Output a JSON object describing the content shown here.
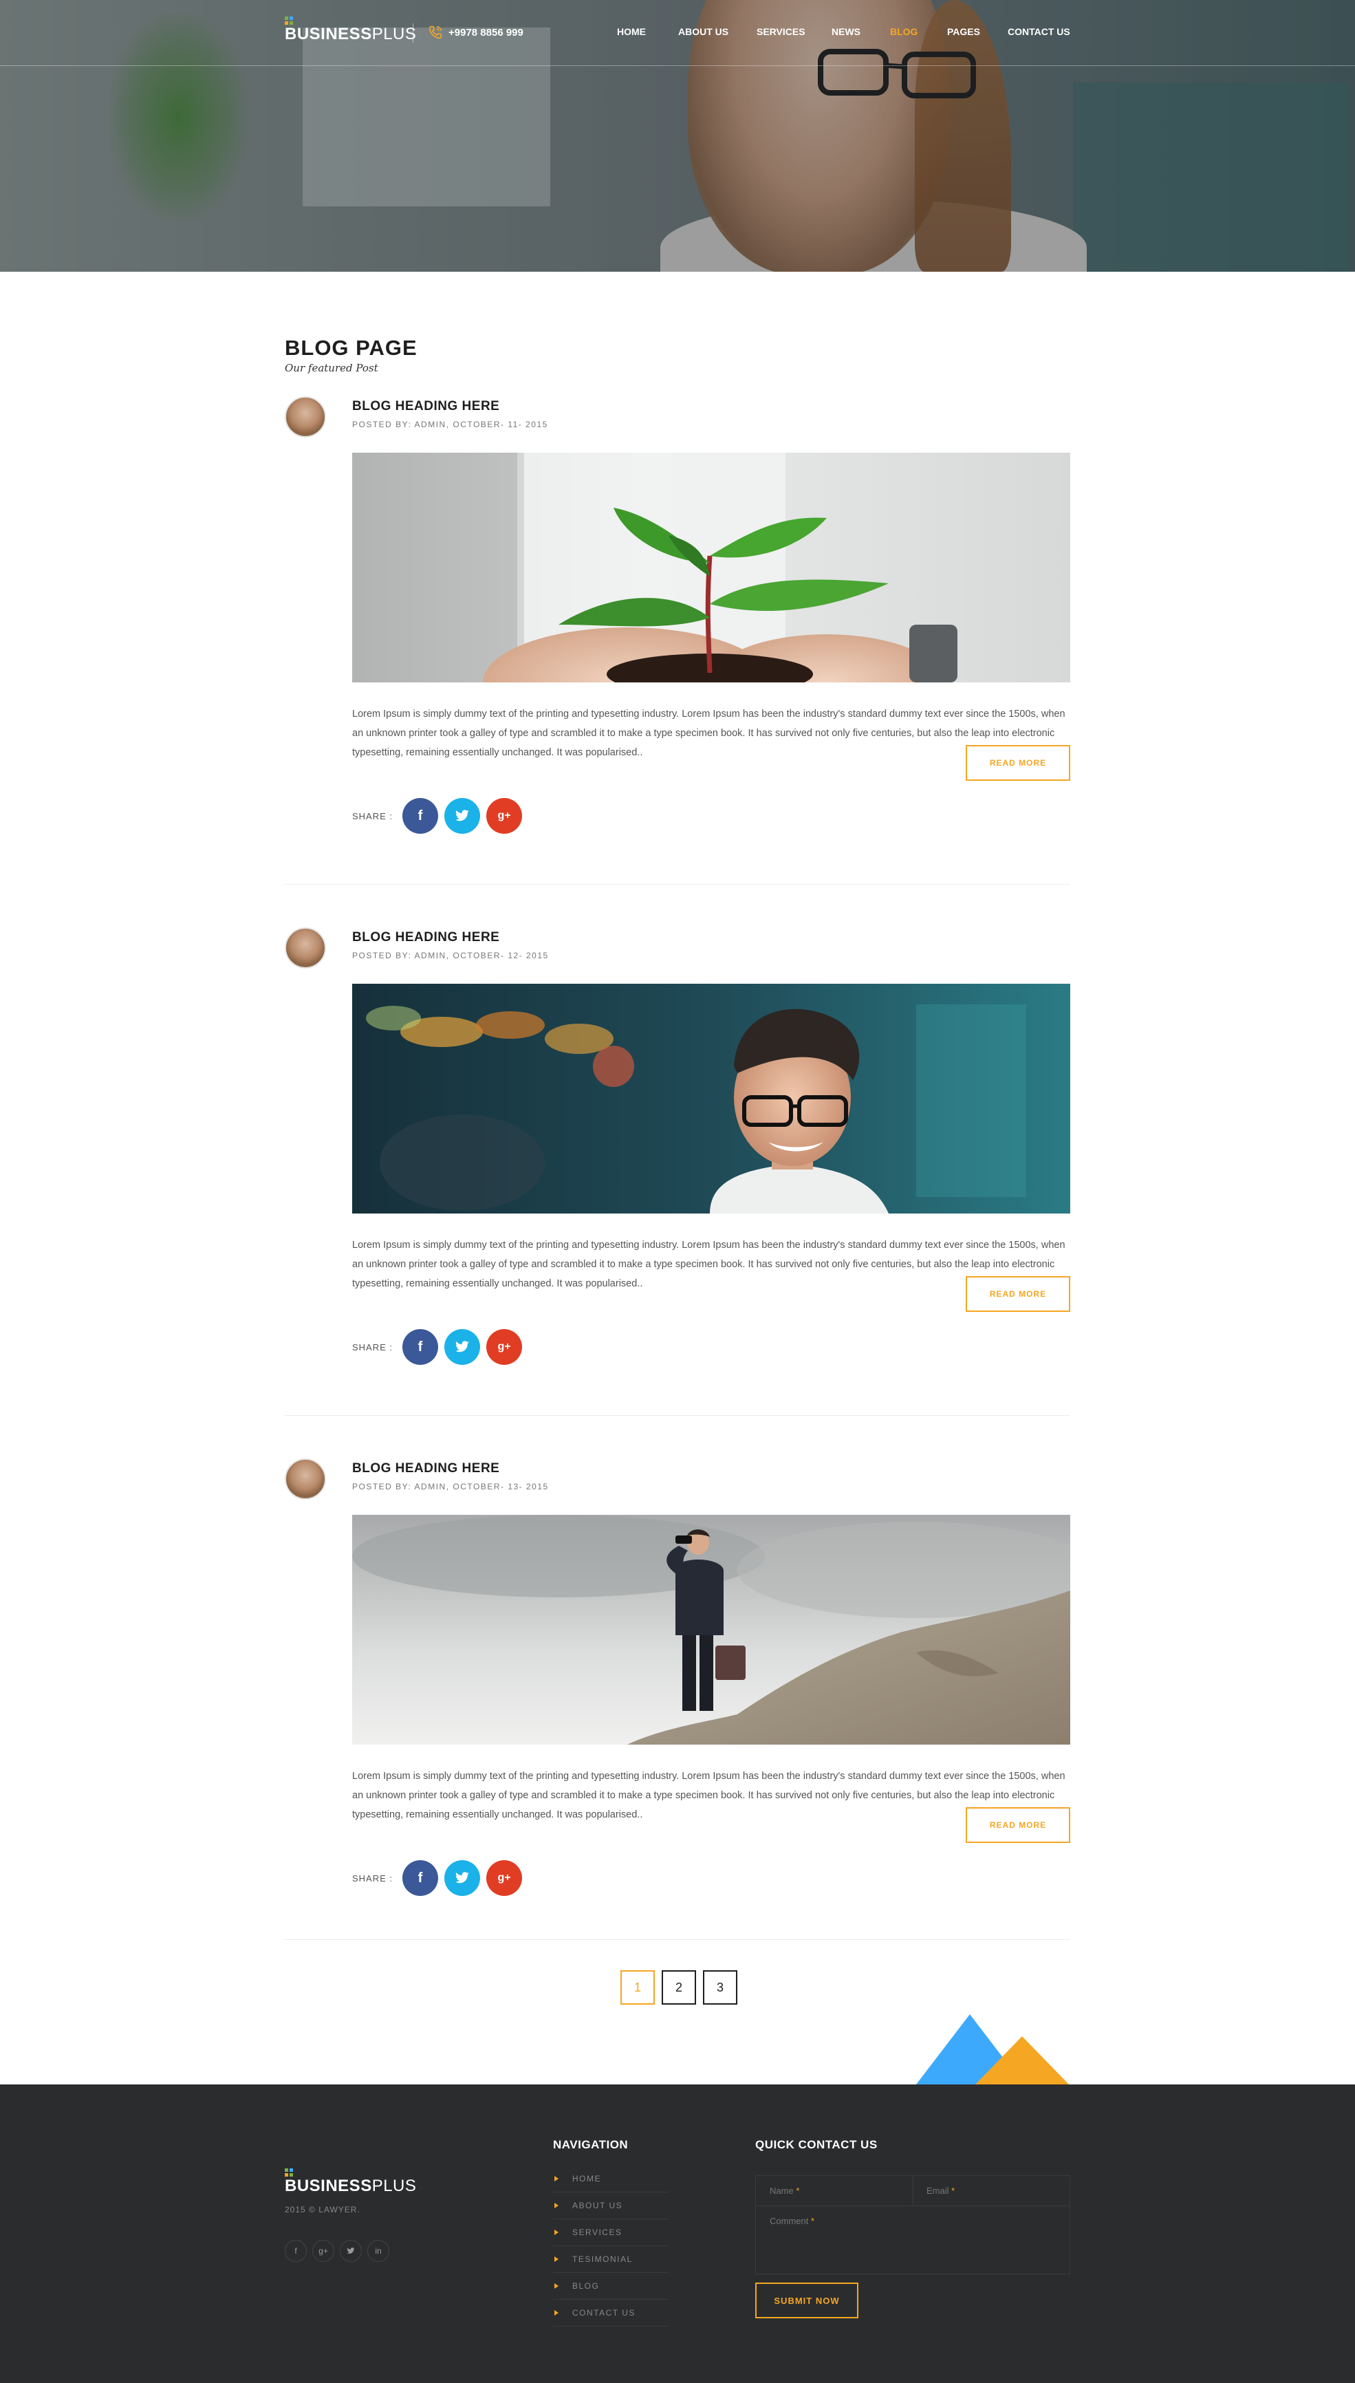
{
  "brand": {
    "name_bold": "BUSINESS",
    "name_light": "PLUS",
    "colors": {
      "accent": "#f5a623",
      "dot_green": "#7cb342",
      "dot_blue": "#3da9fc",
      "dot_orange": "#f5a623"
    }
  },
  "header": {
    "phone_icon": "phone-icon",
    "phone": "+9978 8856 999",
    "nav": [
      "HOME",
      "ABOUT US",
      "SERVICES",
      "NEWS",
      "BLOG",
      "PAGES",
      "CONTACT US"
    ],
    "active_nav": "BLOG"
  },
  "page": {
    "title": "BLOG PAGE",
    "subtitle": "Our featured Post"
  },
  "posts": [
    {
      "title": "BLOG HEADING HERE",
      "meta": "POSTED BY: ADMIN,  OCTOBER- 11- 2015",
      "image": "plant-in-hands",
      "text": "Lorem Ipsum is simply dummy text of the printing and typesetting industry. Lorem Ipsum has been the industry's standard dummy text ever since the 1500s, when an unknown printer took a galley of type and scrambled it to make a type specimen book. It has survived not only five centuries, but also the leap into electronic typesetting, remaining essentially unchanged. It was popularised..",
      "share_label": "SHARE :",
      "read_more": "READ MORE"
    },
    {
      "title": "BLOG HEADING HERE",
      "meta": "POSTED BY: ADMIN,  OCTOBER- 12- 2015",
      "image": "smiling-man-with-glasses",
      "text": "Lorem Ipsum is simply dummy text of the printing and typesetting industry. Lorem Ipsum has been the industry's standard dummy text ever since the 1500s, when an unknown printer took a galley of type and scrambled it to make a type specimen book. It has survived not only five centuries, but also the leap into electronic typesetting, remaining essentially unchanged. It was popularised..",
      "share_label": "SHARE :",
      "read_more": "READ MORE"
    },
    {
      "title": "BLOG HEADING HERE",
      "meta": "POSTED BY: ADMIN,  OCTOBER- 13- 2015",
      "image": "businessman-with-binoculars-on-rock",
      "text": "Lorem Ipsum is simply dummy text of the printing and typesetting industry. Lorem Ipsum has been the industry's standard dummy text ever since the 1500s, when an unknown printer took a galley of type and scrambled it to make a type specimen book. It has survived not only five centuries, but also the leap into electronic typesetting, remaining essentially unchanged. It was popularised..",
      "share_label": "SHARE :",
      "read_more": "READ MORE"
    }
  ],
  "social_icons": {
    "facebook": "f",
    "twitter": "twitter-bird-icon",
    "google_plus": "g+"
  },
  "pagination": {
    "pages": [
      "1",
      "2",
      "3"
    ],
    "active": "1"
  },
  "footer": {
    "copyright": "2015 © LAWYER.",
    "social": [
      "f",
      "g+",
      "twitter-bird-icon",
      "in"
    ],
    "nav_title": "NAVIGATION",
    "nav_items": [
      "HOME",
      "ABOUT US",
      "SERVICES",
      "TESIMONIAL",
      "BLOG",
      "CONTACT US"
    ],
    "contact_title": "QUICK CONTACT US",
    "form": {
      "name": "Name",
      "email": "Email",
      "comment": "Comment",
      "required_mark": "*",
      "submit": "SUBMIT NOW"
    }
  }
}
